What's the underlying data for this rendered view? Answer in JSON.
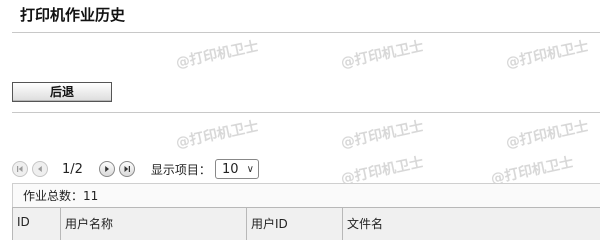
{
  "header": {
    "title": "打印机作业历史"
  },
  "toolbar": {
    "back_label": "后退"
  },
  "pager": {
    "page_indicator": "1/2",
    "per_page_label": "显示项目：",
    "per_page_value": "10"
  },
  "summary": {
    "total_jobs": "作业总数：11"
  },
  "table": {
    "columns": [
      "ID",
      "用户名称",
      "用户ID",
      "文件名"
    ]
  },
  "watermark": {
    "text": "@打印机卫士"
  }
}
